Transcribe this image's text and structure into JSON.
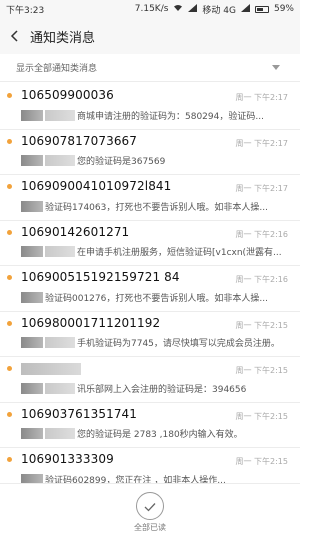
{
  "status_bar": {
    "time": "下午3:23",
    "speed": "7.15K/s",
    "carrier": "移动 4G",
    "battery": "59%"
  },
  "header": {
    "title": "通知类消息"
  },
  "filter": {
    "label": "显示全部通知类消息"
  },
  "messages": [
    {
      "sender": "106509900036",
      "time": "周一 下午2:17",
      "preview": "商城申请注册的验证码为：580294，验证码..."
    },
    {
      "sender": "106907817073667",
      "time": "周一 下午2:17",
      "preview": "您的验证码是367569"
    },
    {
      "sender": "1069090041010972l841",
      "time": "周一 下午2:17",
      "preview": "验证码174063，打死也不要告诉别人哦。如非本人操..."
    },
    {
      "sender": "10690142601271",
      "time": "周一 下午2:16",
      "preview": "在申请手机注册服务，短信验证码[v1cxn(泄露有..."
    },
    {
      "sender": "106900515192159721 84",
      "time": "周一 下午2:16",
      "preview": "验证码001276，打死也不要告诉别人哦。如非本人操..."
    },
    {
      "sender": "106980001711201192",
      "time": "周一 下午2:15",
      "preview": "手机验证码为7745，请尽快填写以完成会员注册。"
    },
    {
      "sender": "",
      "time": "周一 下午2:15",
      "preview": "讯乐部网上入会注册的验证码是：394656"
    },
    {
      "sender": "106903761351741",
      "time": "周一 下午2:15",
      "preview": "您的验证码是 2783 ,180秒内输入有效。"
    },
    {
      "sender": "106901333309",
      "time": "周一 下午2:15",
      "preview": "验证码602899，您正在注 ，如非本人操作..."
    }
  ],
  "bottom": {
    "mark_all_read_label": "全部已读"
  }
}
